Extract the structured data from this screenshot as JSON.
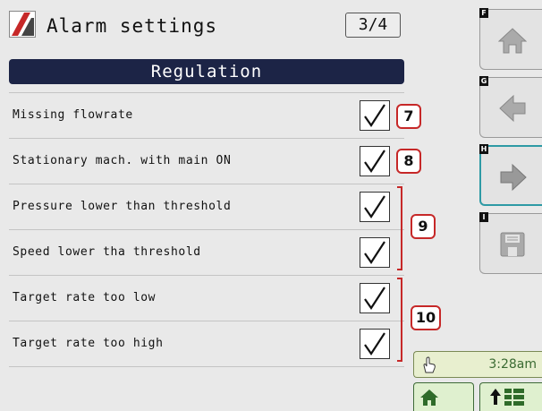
{
  "header": {
    "title": "Alarm settings",
    "page_indicator": "3/4"
  },
  "section": {
    "title": "Regulation"
  },
  "rows": [
    {
      "label": "Missing flowrate",
      "checked": true
    },
    {
      "label": "Stationary mach. with main ON",
      "checked": true
    },
    {
      "label": "Pressure lower than threshold",
      "checked": true
    },
    {
      "label": "Speed lower tha threshold",
      "checked": true
    },
    {
      "label": "Target rate too low",
      "checked": true
    },
    {
      "label": "Target rate too high",
      "checked": true
    }
  ],
  "callouts": [
    "7",
    "8",
    "9",
    "10"
  ],
  "side_buttons": [
    {
      "key": "F",
      "icon": "home-icon"
    },
    {
      "key": "G",
      "icon": "arrow-left-icon"
    },
    {
      "key": "H",
      "icon": "arrow-right-icon",
      "active": true
    },
    {
      "key": "I",
      "icon": "save-icon"
    }
  ],
  "status": {
    "time": "3:28am",
    "icon": "touch-hand-icon"
  },
  "bottom_buttons": [
    {
      "icon": "home-icon"
    },
    {
      "icon": "up-arrow-grid-icon"
    }
  ],
  "colors": {
    "section_bar": "#1c2446",
    "callout_border": "#c62828",
    "active_border": "#2e9aa5",
    "status_text": "#3a6a32"
  }
}
